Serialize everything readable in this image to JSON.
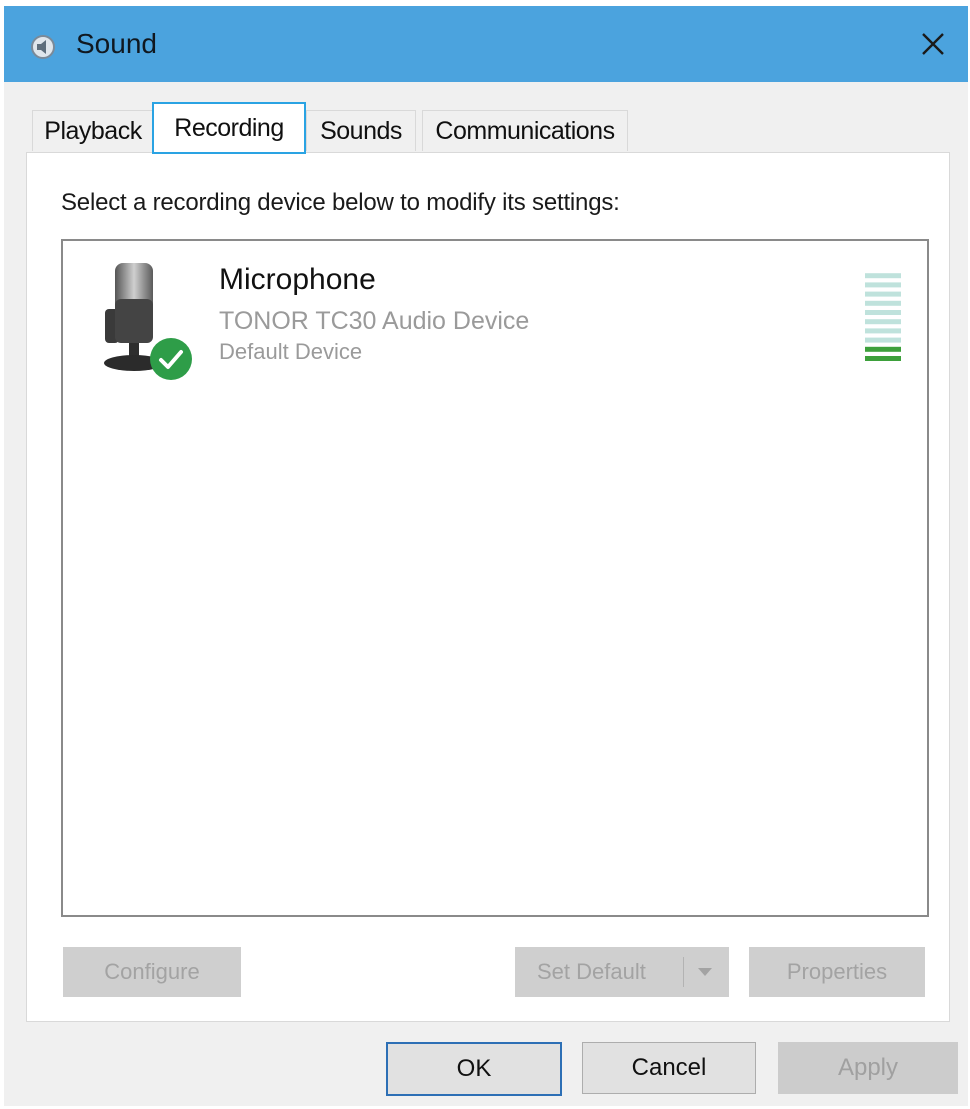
{
  "window": {
    "title": "Sound",
    "icon": "speaker-icon",
    "close_icon": "close-icon"
  },
  "tabs": [
    {
      "label": "Playback",
      "active": false
    },
    {
      "label": "Recording",
      "active": true
    },
    {
      "label": "Sounds",
      "active": false
    },
    {
      "label": "Communications",
      "active": false
    }
  ],
  "recording": {
    "instruction": "Select a recording device below to modify its settings:",
    "devices": [
      {
        "name": "Microphone",
        "description": "TONOR TC30 Audio Device",
        "status": "Default Device",
        "icon": "microphone-icon",
        "badge_icon": "checkmark-icon",
        "badge_color": "#2e9d48",
        "level_meter": {
          "segments": 10,
          "active_segments": 2,
          "active_color": "#3da03b",
          "idle_color": "#bfe2dc"
        }
      }
    ]
  },
  "panel_buttons": {
    "configure": "Configure",
    "set_default": "Set Default",
    "properties": "Properties"
  },
  "dialog_buttons": {
    "ok": "OK",
    "cancel": "Cancel",
    "apply": "Apply"
  },
  "colors": {
    "titlebar": "#4ba3de",
    "active_tab_border": "#2aa3e3",
    "ok_border": "#2d6fb5"
  }
}
